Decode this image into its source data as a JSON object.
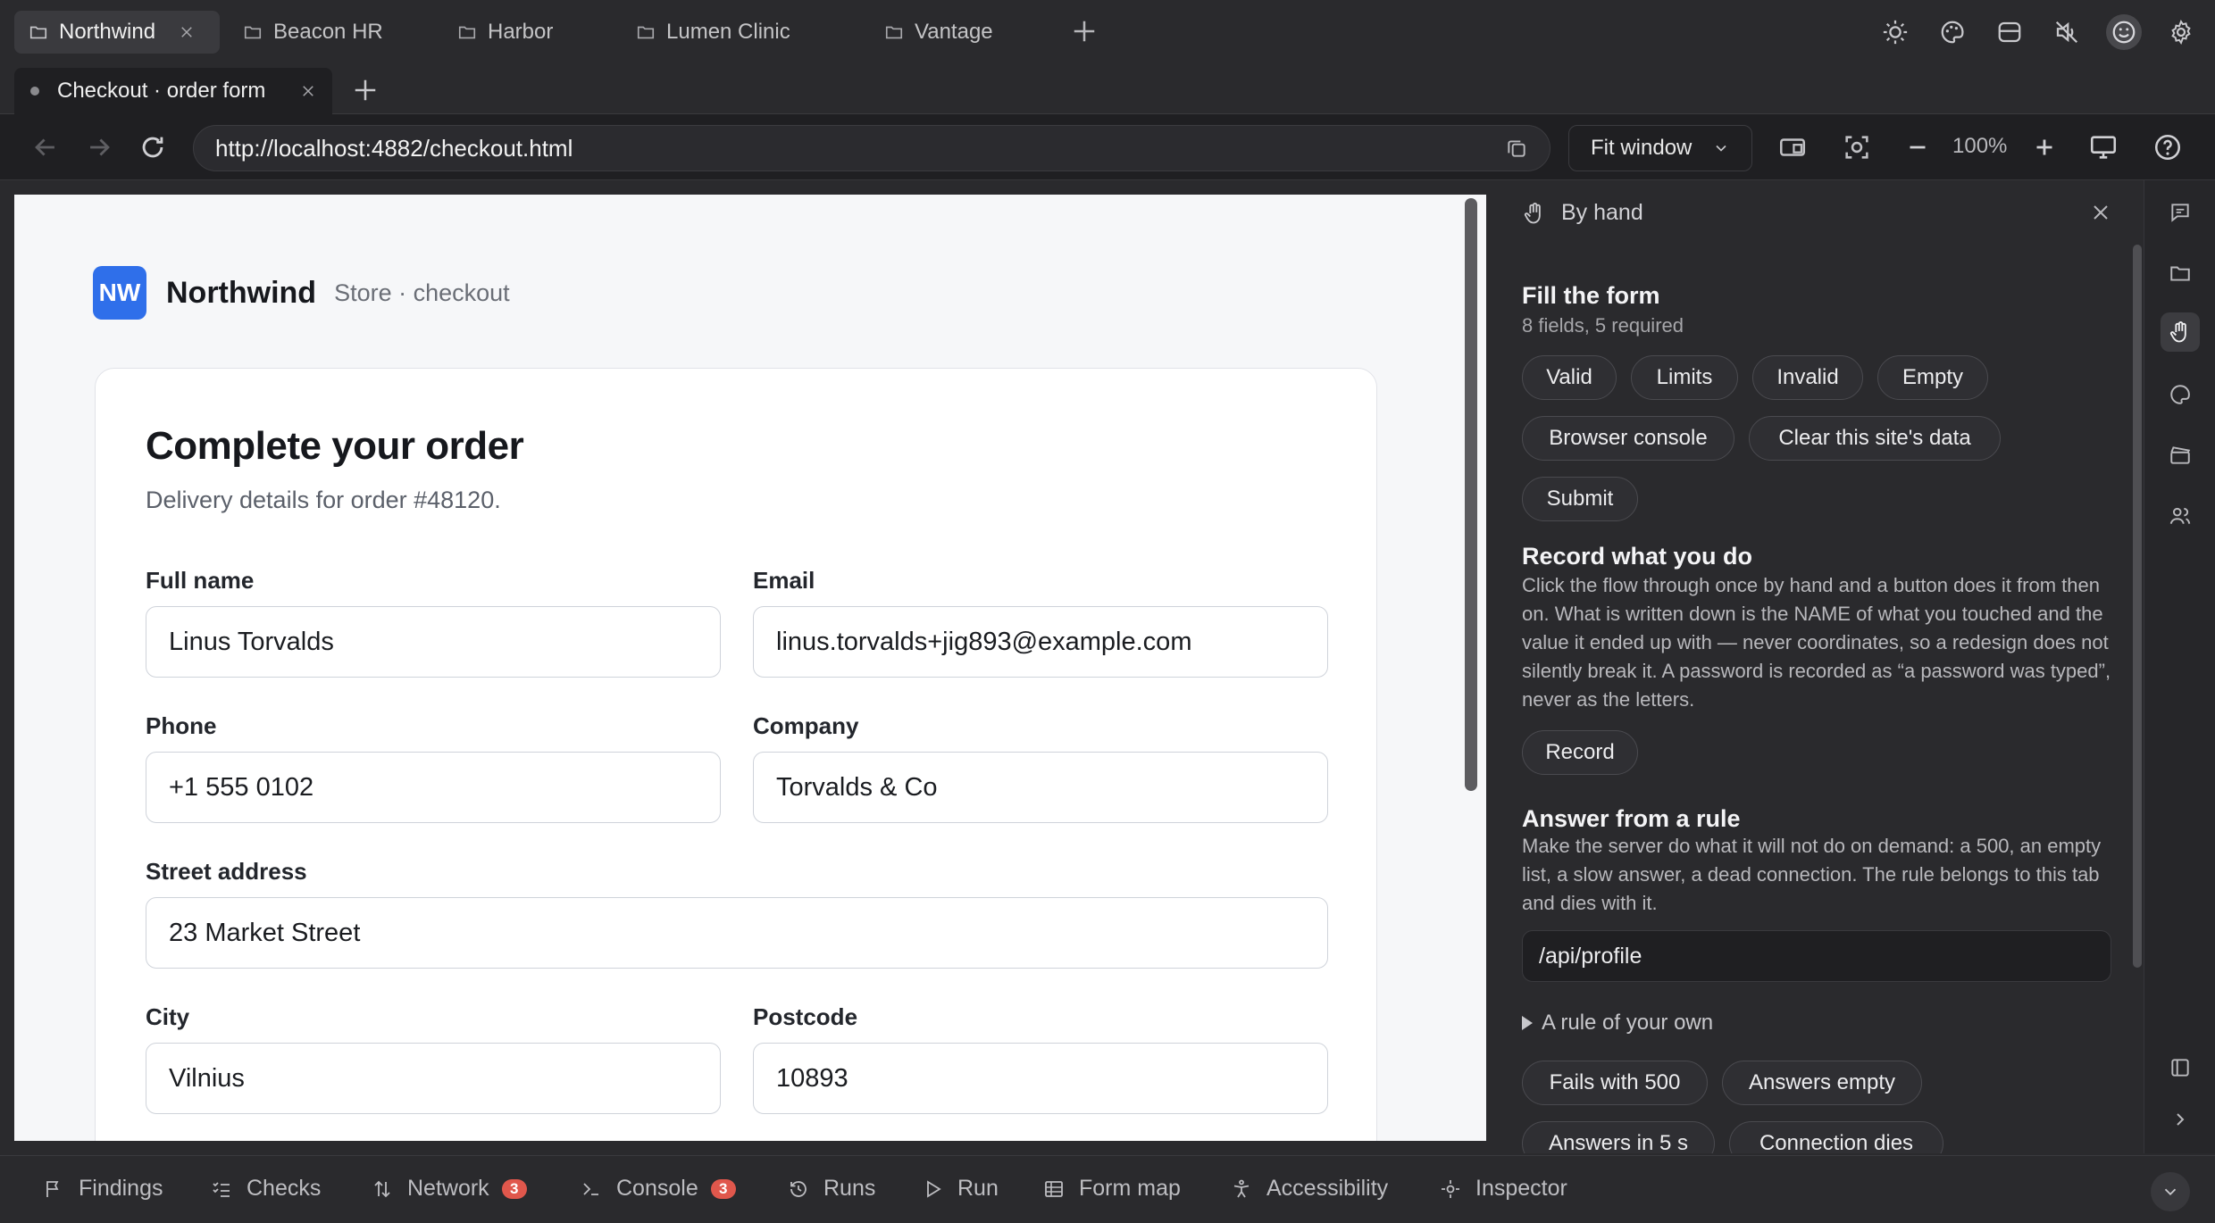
{
  "workspace_tabs": [
    {
      "label": "Northwind",
      "active": true
    },
    {
      "label": "Beacon HR",
      "active": false
    },
    {
      "label": "Harbor",
      "active": false
    },
    {
      "label": "Lumen Clinic",
      "active": false
    },
    {
      "label": "Vantage",
      "active": false
    }
  ],
  "page_tab": {
    "title": "Checkout · order form"
  },
  "address": {
    "url": "http://localhost:4882/checkout.html",
    "fit_label": "Fit window",
    "zoom": "100%"
  },
  "page": {
    "logo": "NW",
    "brand": "Northwind",
    "brand_sub": "Store · checkout",
    "title": "Complete your order",
    "subtitle": "Delivery details for order #48120.",
    "fields": {
      "full_name": {
        "label": "Full name",
        "value": "Linus Torvalds"
      },
      "email": {
        "label": "Email",
        "value": "linus.torvalds+jig893@example.com"
      },
      "phone": {
        "label": "Phone",
        "value": "+1 555 0102"
      },
      "company": {
        "label": "Company",
        "value": "Torvalds & Co"
      },
      "street": {
        "label": "Street address",
        "value": "23 Market Street"
      },
      "city": {
        "label": "City",
        "value": "Vilnius"
      },
      "postcode": {
        "label": "Postcode",
        "value": "10893"
      }
    }
  },
  "panel": {
    "title": "By hand",
    "fill": {
      "heading": "Fill the form",
      "sub": "8 fields, 5 required",
      "buttons": [
        "Valid",
        "Limits",
        "Invalid",
        "Empty",
        "Browser console",
        "Clear this site's data",
        "Submit"
      ]
    },
    "record": {
      "heading": "Record what you do",
      "text": "Click the flow through once by hand and a button does it from then on. What is written down is the NAME of what you touched and the value it ended up with — never coordinates, so a redesign does not silently break it. A password is recorded as “a password was typed”, never as the letters.",
      "button": "Record"
    },
    "rule": {
      "heading": "Answer from a rule",
      "text": "Make the server do what it will not do on demand: a 500, an empty list, a slow answer, a dead connection. The rule belongs to this tab and dies with it.",
      "input_value": "/api/profile",
      "details": "A rule of your own",
      "buttons": [
        "Fails with 500",
        "Answers empty",
        "Answers in 5 s",
        "Connection dies"
      ]
    }
  },
  "bottom_tabs": [
    {
      "label": "Findings",
      "icon": "flag-icon"
    },
    {
      "label": "Checks",
      "icon": "checklist-icon"
    },
    {
      "label": "Network",
      "icon": "arrows-updown-icon",
      "badge": "3"
    },
    {
      "label": "Console",
      "icon": "terminal-icon",
      "badge": "3"
    },
    {
      "label": "Runs",
      "icon": "history-icon"
    },
    {
      "label": "Run",
      "icon": "play-icon"
    },
    {
      "label": "Form map",
      "icon": "table-icon"
    },
    {
      "label": "Accessibility",
      "icon": "accessibility-icon"
    },
    {
      "label": "Inspector",
      "icon": "inspector-icon"
    }
  ],
  "colors": {
    "accent": "#2f6fea",
    "badge": "#e0574c"
  }
}
